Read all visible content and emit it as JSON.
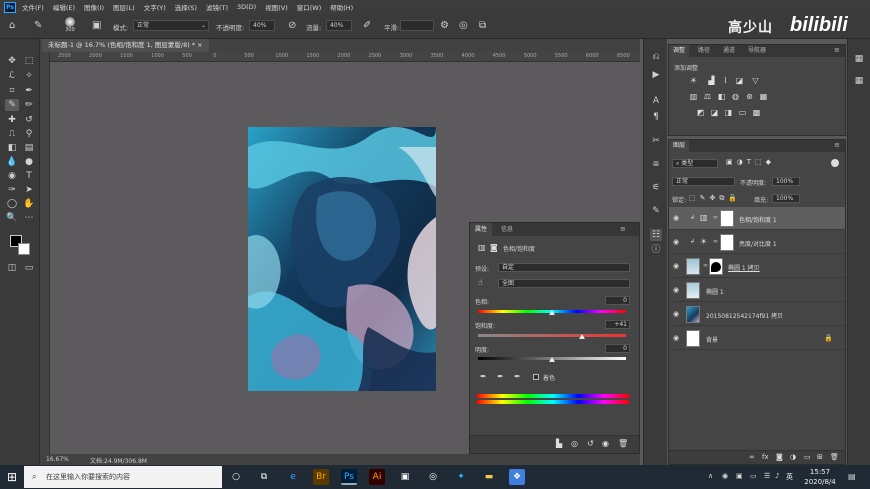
{
  "menubar": {
    "logo": "Ps",
    "items": [
      "文件(F)",
      "编辑(E)",
      "图像(I)",
      "图层(L)",
      "文字(Y)",
      "选择(S)",
      "滤镜(T)",
      "3D(D)",
      "视图(V)",
      "窗口(W)",
      "帮助(H)"
    ]
  },
  "options": {
    "size": "300",
    "mode_label": "模式:",
    "mode_value": "正常",
    "opacity_label": "不透明度:",
    "opacity_value": "40%",
    "flow_label": "流量:",
    "flow_value": "40%",
    "smooth_label": "平滑:"
  },
  "watermark": {
    "name": "高少山",
    "brand": "bilibili"
  },
  "document": {
    "tab_title": "未标题-1 @ 16.7% (色相/饱和度 1, 图层蒙版/8) *",
    "ruler_ticks": [
      "2500",
      "2000",
      "1500",
      "1000",
      "500",
      "0",
      "500",
      "1000",
      "1500",
      "2000",
      "2500",
      "3000",
      "3500",
      "4000",
      "4500",
      "5000",
      "5500",
      "6000",
      "6500"
    ]
  },
  "status": {
    "zoom": "16.67%",
    "doc": "文档:24.9M/306.8M"
  },
  "properties": {
    "tabs": [
      "属性",
      "信息"
    ],
    "title": "色相/饱和度",
    "preset_label": "预设:",
    "preset_value": "自定",
    "channel_value": "全图",
    "hue_label": "色相:",
    "hue_value": "0",
    "saturation_label": "饱和度:",
    "saturation_value": "+41",
    "lightness_label": "明度:",
    "lightness_value": "0",
    "colorize_label": "着色",
    "slider_levels": {
      "hue": 0.5,
      "saturation": 0.7,
      "lightness": 0.5
    }
  },
  "adjustments": {
    "tabs": [
      "调整",
      "路径",
      "通道",
      "导航器"
    ],
    "add_label": "添加调整"
  },
  "layers": {
    "tab": "图层",
    "filter_value": "类型",
    "blend_value": "正常",
    "opacity_label": "不透明度:",
    "opacity_value": "100%",
    "lock_label": "锁定:",
    "fill_label": "填充:",
    "fill_value": "100%",
    "items": [
      {
        "name": "色相/饱和度 1"
      },
      {
        "name": "亮度/对比度 1"
      },
      {
        "name": "椭圆 1 拷贝"
      },
      {
        "name": "椭圆 1"
      },
      {
        "name": "20150812542174f91 拷贝"
      },
      {
        "name": "背景"
      }
    ]
  },
  "taskbar": {
    "search_placeholder": "在这里输入你要搜索的内容",
    "time": "15:57",
    "date": "2020/8/4",
    "ime": "英"
  }
}
